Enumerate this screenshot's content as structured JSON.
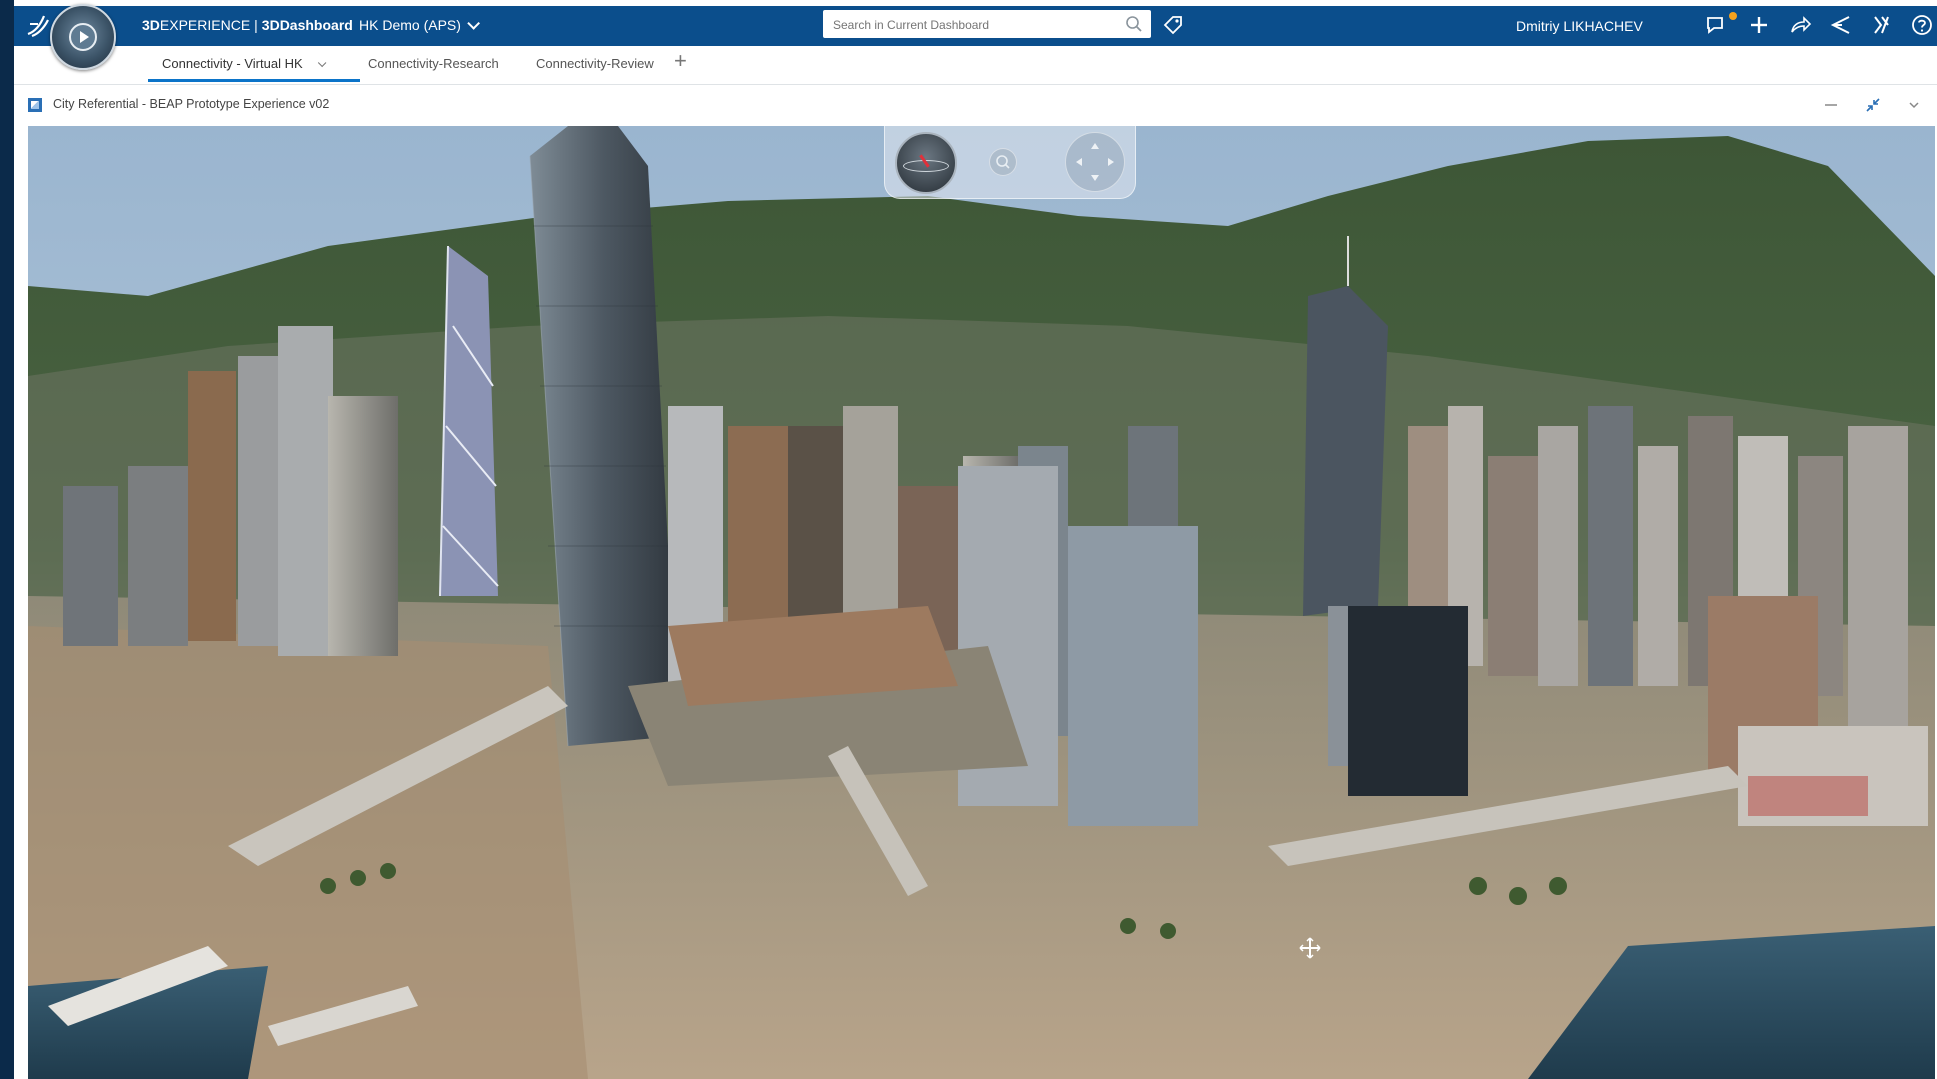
{
  "app": {
    "brand_3d": "3D",
    "brand_experience": "EXPERIENCE",
    "separator": "|",
    "brand_dashboard": "3DDashboard",
    "platform": "HK Demo (APS)"
  },
  "search": {
    "placeholder": "Search in Current Dashboard"
  },
  "user": {
    "name": "Dmitriy LIKHACHEV"
  },
  "tabs": [
    {
      "label": "Connectivity - Virtual HK",
      "active": true
    },
    {
      "label": "Connectivity-Research",
      "active": false
    },
    {
      "label": "Connectivity-Review",
      "active": false
    }
  ],
  "add_tab": "+",
  "widget": {
    "title": "City Referential - BEAP Prototype Experience v02"
  },
  "toolbar_icons": [
    "tag-icon",
    "notification-icon",
    "plus-icon",
    "share-icon",
    "send-icon",
    "collaborate-icon",
    "help-icon"
  ],
  "colors": {
    "topbar": "#0b4e8c",
    "accent": "#0b74c9",
    "notification": "#f6a21e"
  }
}
